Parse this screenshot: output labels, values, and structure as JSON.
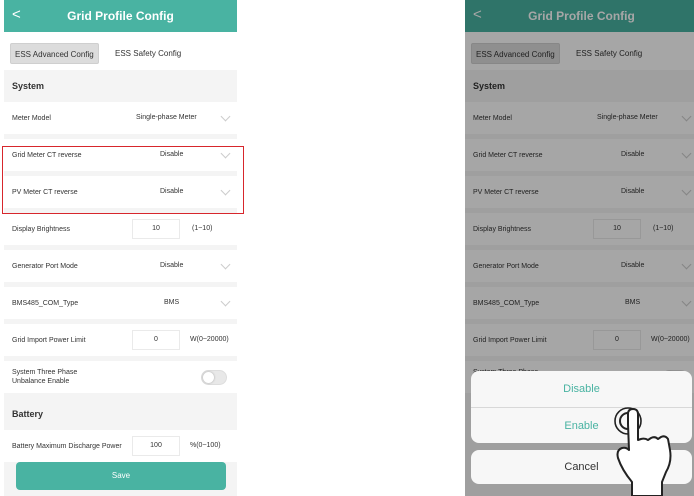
{
  "title": "Grid Profile Config",
  "back_icon": "<",
  "tabs": [
    "ESS Advanced Config",
    "ESS Safety Config"
  ],
  "sections": {
    "system": "System",
    "battery": "Battery"
  },
  "rows": [
    {
      "label": "Meter Model",
      "value": "Single-phase Meter"
    },
    {
      "label": "Grid Meter CT reverse",
      "value": "Disable"
    },
    {
      "label": "PV Meter CT reverse",
      "value": "Disable"
    },
    {
      "label": "Display Brightness",
      "value": "10",
      "unit": "(1~10)"
    },
    {
      "label": "Generator Port Mode",
      "value": "Disable"
    },
    {
      "label": "BMS485_COM_Type",
      "value": "BMS"
    },
    {
      "label": "Grid Import Power Limit",
      "value": "0",
      "unit": "W(0~20000)"
    },
    {
      "label": "System Three Phase Unbalance Enable"
    },
    {
      "label": "Battery Maximum Discharge Power",
      "value": "100",
      "unit": "%(0~100)"
    }
  ],
  "save_label": "Save",
  "sheet": {
    "options": [
      "Disable",
      "Enable"
    ],
    "cancel": "Cancel"
  },
  "colors": {
    "accent": "#49b3a2",
    "highlight": "#d7262c"
  },
  "icons": {
    "back": "chevron-left-icon",
    "dropdown": "chevron-down-icon",
    "hand": "pointing-hand-icon"
  }
}
